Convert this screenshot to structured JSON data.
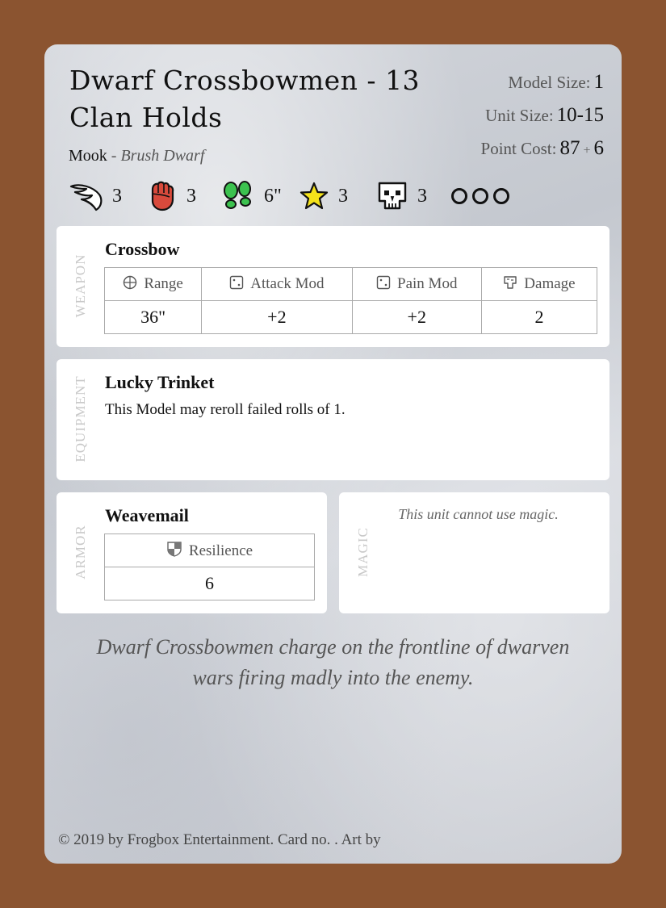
{
  "card": {
    "title_line1": "Dwarf Crossbowmen - 13",
    "title_line2": "Clan Holds",
    "type": "Mook",
    "separator": "-",
    "race": "Brush Dwarf",
    "model_size_label": "Model Size:",
    "model_size": "1",
    "unit_size_label": "Unit Size:",
    "unit_size": "10-15",
    "point_cost_label": "Point Cost:",
    "point_cost": "87",
    "point_cost_plus": "+",
    "point_cost_extra": "6",
    "attributes": [
      {
        "icon": "wing-icon",
        "value": "3"
      },
      {
        "icon": "fist-icon",
        "value": "3"
      },
      {
        "icon": "footprints-icon",
        "value": "6\""
      },
      {
        "icon": "star-icon",
        "value": "3"
      },
      {
        "icon": "skull-icon",
        "value": "3"
      }
    ],
    "wound_circles": 3,
    "weapon": {
      "section_label": "WEAPON",
      "name": "Crossbow",
      "headers": [
        "Range",
        "Attack Mod",
        "Pain Mod",
        "Damage"
      ],
      "header_icons": [
        "crosshair-icon",
        "die-icon",
        "die-icon",
        "broken-shield-icon"
      ],
      "values": [
        "36\"",
        "+2",
        "+2",
        "2"
      ]
    },
    "equipment": {
      "section_label": "EQUIPMENT",
      "name": "Lucky Trinket",
      "description": "This Model may reroll failed rolls of 1."
    },
    "armor": {
      "section_label": "ARMOR",
      "name": "Weavemail",
      "header": "Resilience",
      "header_icon": "shield-icon",
      "value": "6"
    },
    "magic": {
      "section_label": "MAGIC",
      "text": "This unit cannot use magic."
    },
    "flavor_line1": "Dwarf Crossbowmen charge on the frontline of dwarven",
    "flavor_line2": "wars firing madly into the enemy.",
    "footer": "© 2019 by Frogbox Entertainment. Card no. . Art by"
  },
  "colors": {
    "border": "#8b5430",
    "fist": "#d84a3c",
    "footprints": "#3cc24f",
    "star": "#f4e21a"
  }
}
